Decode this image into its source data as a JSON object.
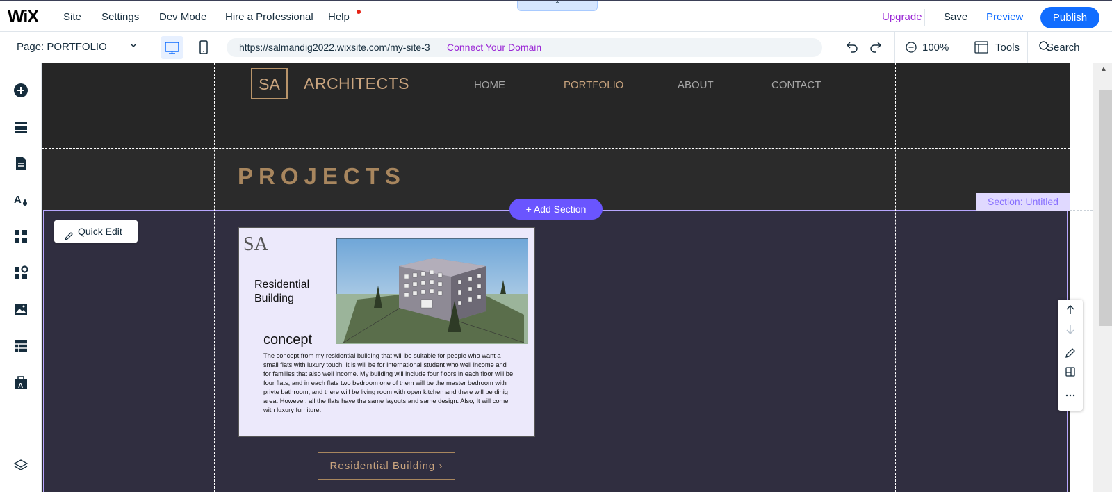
{
  "topbar": {
    "logo": "WiX",
    "menu": [
      "Site",
      "Settings",
      "Dev Mode",
      "Hire a Professional",
      "Help"
    ],
    "upgrade": "Upgrade",
    "save": "Save",
    "preview": "Preview",
    "publish": "Publish",
    "collapse_arrow": "⌃"
  },
  "secondbar": {
    "page_selector": "Page: PORTFOLIO",
    "url": "https://salmandig2022.wixsite.com/my-site-3",
    "connect_domain": "Connect Your Domain",
    "zoom": "100%",
    "tools": "Tools",
    "search": "Search"
  },
  "site": {
    "logo_initials": "SA",
    "name": "ARCHITECTS",
    "nav": [
      "HOME",
      "PORTFOLIO",
      "ABOUT",
      "CONTACT"
    ],
    "active_nav": "PORTFOLIO",
    "projects_heading": "PROJECTS"
  },
  "editor": {
    "section_tag": "Section: Untitled",
    "add_section": "+ Add Section",
    "quick_edit": "Quick Edit"
  },
  "card": {
    "sa": "SA",
    "title": "Residential Building",
    "concept": "concept",
    "body": "The concept from my residential building that will be suitable for people who want a small flats with luxury touch. It is will be for international student who well income and for families that also well income. My building will include four floors in each floor will be four flats, and in each flats two bedroom one of them will be the master bedroom with privte bathroom, and there will be living room with open kitchen and there will be dinig area. However, all the flats have the same layouts and same design. Also, It will come with luxury furniture.",
    "button": "Residential Building ›"
  },
  "colors": {
    "accent_purple": "#6a55ff",
    "wix_blue": "#116dff",
    "site_gold": "#c9a47e",
    "upgrade_purple": "#9a27d5"
  }
}
